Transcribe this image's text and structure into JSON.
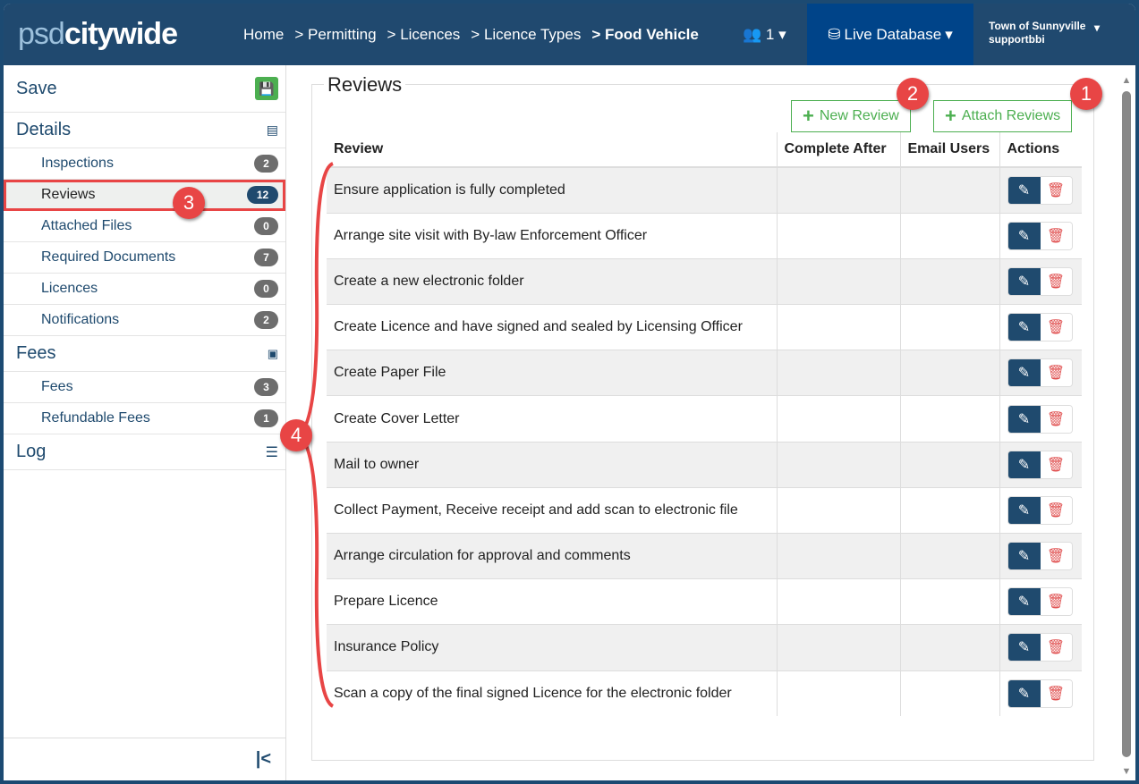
{
  "header": {
    "logo": "psdcitywide",
    "logo_a": "psd",
    "logo_b": "citywide",
    "breadcrumbs": [
      "Home",
      "> Permitting",
      "> Licences",
      "> Licence Types",
      "> Food Vehicle"
    ],
    "users_count": "1",
    "database": "Live Database",
    "org": "Town of Sunnyville",
    "user": "supportbbi"
  },
  "sidebar": {
    "save": "Save",
    "sections": [
      {
        "label": "Details",
        "items": [
          {
            "label": "Inspections",
            "count": "2"
          },
          {
            "label": "Reviews",
            "count": "12"
          },
          {
            "label": "Attached Files",
            "count": "0"
          },
          {
            "label": "Required Documents",
            "count": "7"
          },
          {
            "label": "Licences",
            "count": "0"
          },
          {
            "label": "Notifications",
            "count": "2"
          }
        ]
      },
      {
        "label": "Fees",
        "items": [
          {
            "label": "Fees",
            "count": "3"
          },
          {
            "label": "Refundable Fees",
            "count": "1"
          }
        ]
      },
      {
        "label": "Log"
      }
    ]
  },
  "main": {
    "title": "Reviews",
    "new_review": "New Review",
    "attach_reviews": "Attach Reviews",
    "columns": [
      "Review",
      "Complete After",
      "Email Users",
      "Actions"
    ],
    "rows": [
      "Ensure application is fully completed",
      "Arrange site visit with By-law Enforcement Officer",
      "Create a new electronic folder",
      "Create Licence and have signed and sealed by Licensing Officer",
      "Create Paper File",
      "Create Cover Letter",
      "Mail to owner",
      "Collect Payment, Receive receipt and add scan to electronic file",
      "Arrange circulation for approval and comments",
      "Prepare Licence",
      "Insurance Policy",
      "Scan a copy of the final signed Licence for the electronic folder"
    ]
  },
  "annotations": [
    "1",
    "2",
    "3",
    "4"
  ],
  "colors": {
    "header": "#20496f",
    "database": "#004489",
    "accent_green": "#4caf50",
    "annotation": "#e84545"
  }
}
